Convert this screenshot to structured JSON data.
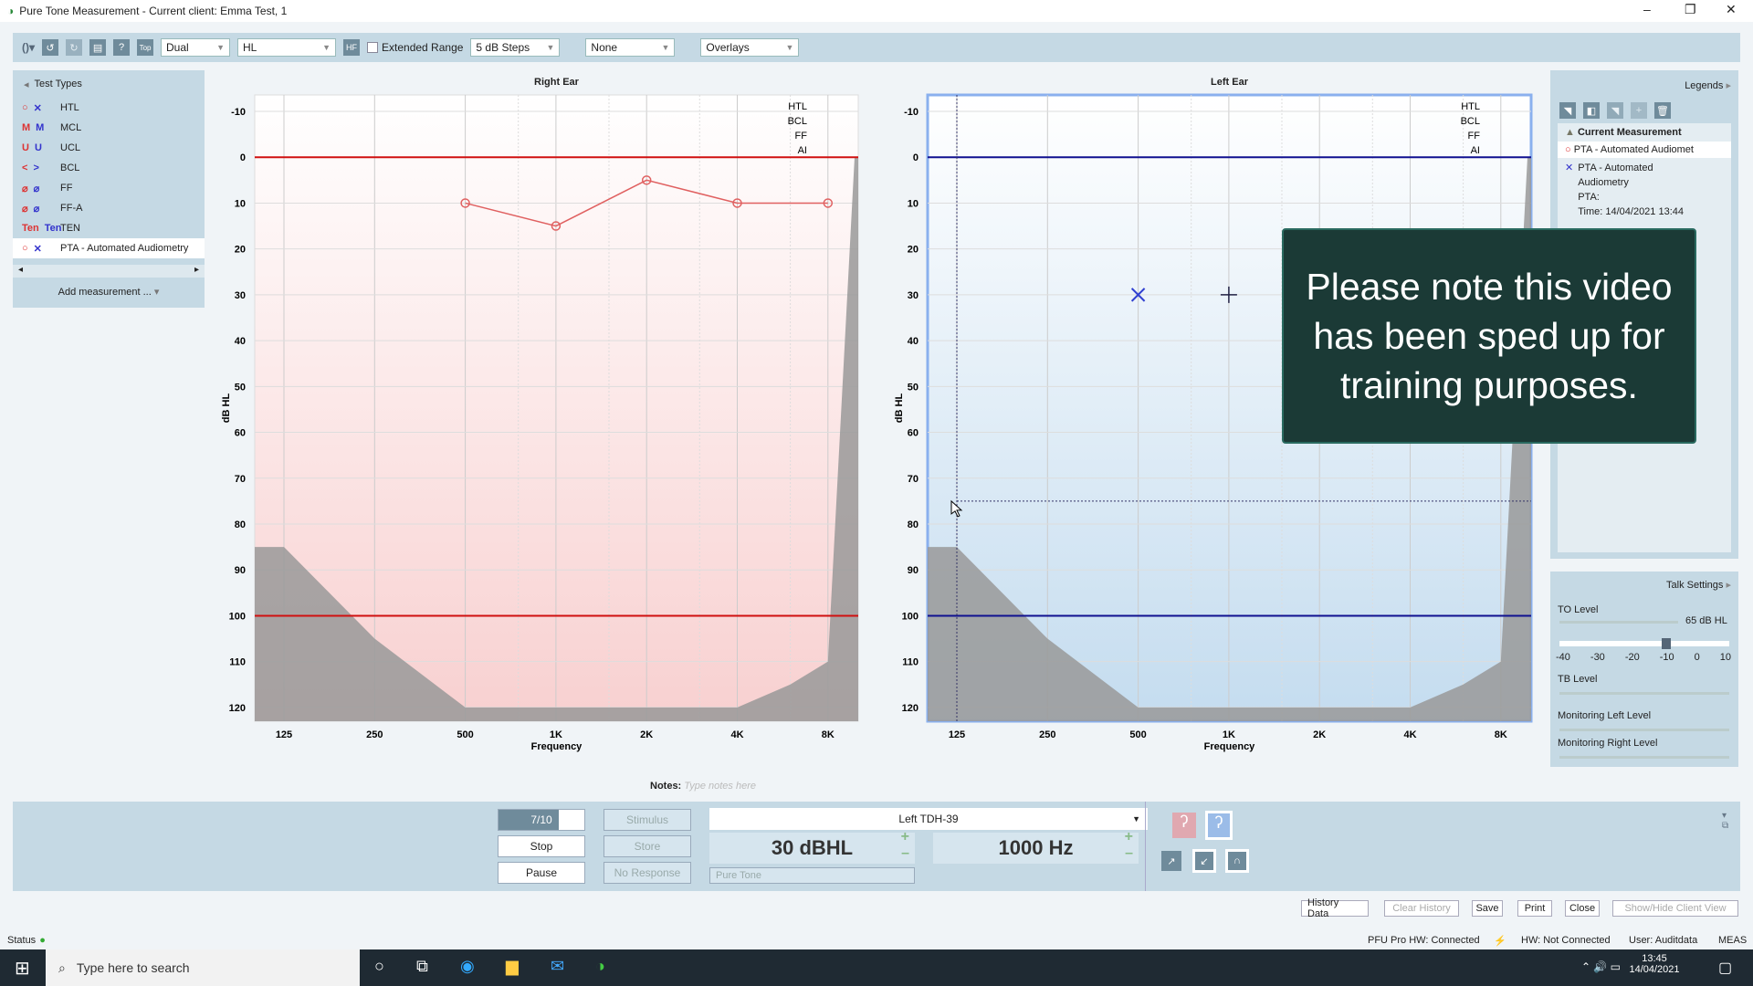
{
  "window": {
    "title": "Pure Tone Measurement - Current client: Emma Test, 1",
    "minimize": "–",
    "restore": "❐",
    "close": "✕"
  },
  "toolbar": {
    "mode": "Dual",
    "scale": "HL",
    "hf": "HF",
    "top": "Top",
    "extended_range": "Extended Range",
    "extended_range_checked": false,
    "steps": "5 dB Steps",
    "masking": "None",
    "overlays": "Overlays"
  },
  "test_types": {
    "header": "Test Types",
    "items": [
      {
        "label": "HTL",
        "right": "○",
        "left": "✕"
      },
      {
        "label": "MCL",
        "right": "M",
        "left": "M"
      },
      {
        "label": "UCL",
        "right": "U",
        "left": "U"
      },
      {
        "label": "BCL",
        "right": "<",
        "left": ">"
      },
      {
        "label": "FF",
        "right": "⌀",
        "left": "⌀"
      },
      {
        "label": "FF-A",
        "right": "⌀",
        "left": "⌀"
      },
      {
        "label": "TEN",
        "right": "Ten",
        "left": "Ten"
      },
      {
        "label": "PTA - Automated Audiometry",
        "right": "○",
        "left": "✕"
      }
    ],
    "add_measurement": "Add measurement ..."
  },
  "charts": {
    "y_label": "dB HL",
    "x_label": "Frequency",
    "y_ticks": [
      "-10",
      "0",
      "10",
      "20",
      "30",
      "40",
      "50",
      "60",
      "70",
      "80",
      "90",
      "100",
      "110",
      "120"
    ],
    "x_ticks": [
      "125",
      "250",
      "500",
      "1K",
      "2K",
      "4K",
      "8K"
    ],
    "legend": [
      "HTL",
      "BCL",
      "FF",
      "AI"
    ],
    "right": {
      "title": "Right Ear",
      "color": "#e06060",
      "line_color": "#d01010",
      "points": [
        {
          "hz": 500,
          "db": 10
        },
        {
          "hz": 1000,
          "db": 15
        },
        {
          "hz": 2000,
          "db": 5
        },
        {
          "hz": 4000,
          "db": 10
        },
        {
          "hz": 8000,
          "db": 10
        }
      ]
    },
    "left": {
      "title": "Left Ear",
      "color": "#3040d0",
      "line_color": "#101090",
      "points": [
        {
          "hz": 500,
          "db": 30
        }
      ],
      "cursor": {
        "hz": 1000,
        "db": 30
      }
    }
  },
  "chart_data": {
    "type": "line",
    "series": [
      {
        "name": "Right Ear",
        "x": [
          500,
          1000,
          2000,
          4000,
          8000
        ],
        "y": [
          10,
          15,
          5,
          10,
          10
        ]
      },
      {
        "name": "Left Ear",
        "x": [
          500
        ],
        "y": [
          30
        ]
      }
    ],
    "xlabel": "Frequency",
    "ylabel": "dB HL",
    "ylim": [
      -10,
      120
    ]
  },
  "legends": {
    "header": "Legends",
    "section": "Current Measurement",
    "item1": "PTA - Automated Audiomet",
    "item2_l1": "PTA - Automated",
    "item2_l2": "Audiometry",
    "item2_l3": "PTA:",
    "item2_l4": "Time:  14/04/2021 13:44"
  },
  "talk": {
    "header": "Talk Settings",
    "to_level": "TO Level",
    "to_value": "65 dB HL",
    "scale": [
      "-40",
      "-30",
      "-20",
      "-10",
      "0",
      "10"
    ],
    "tb_level": "TB Level",
    "mon_left": "Monitoring Left Level",
    "mon_right": "Monitoring Right Level"
  },
  "notes": {
    "label": "Notes:",
    "placeholder": "Type notes here"
  },
  "controls": {
    "progress": "7/10",
    "progress_fraction": 0.7,
    "stop": "Stop",
    "pause": "Pause",
    "stimulus": "Stimulus",
    "store": "Store",
    "no_response": "No Response",
    "transducer": "Left TDH-39",
    "level": "30 dBHL",
    "frequency": "1000 Hz",
    "signal": "Pure Tone"
  },
  "footer": {
    "history": "History Data",
    "clear_history": "Clear History",
    "save": "Save",
    "print": "Print",
    "close": "Close",
    "show_hide": "Show/Hide Client View"
  },
  "status": {
    "label": "Status",
    "hw1": "PFU Pro HW: Connected",
    "hw2": "HW: Not Connected",
    "user": "User: Auditdata",
    "meas": "MEAS"
  },
  "taskbar": {
    "search": "Type here to search",
    "time": "13:45",
    "date": "14/04/2021"
  },
  "overlay": "Please note this video has been sped up for training purposes."
}
